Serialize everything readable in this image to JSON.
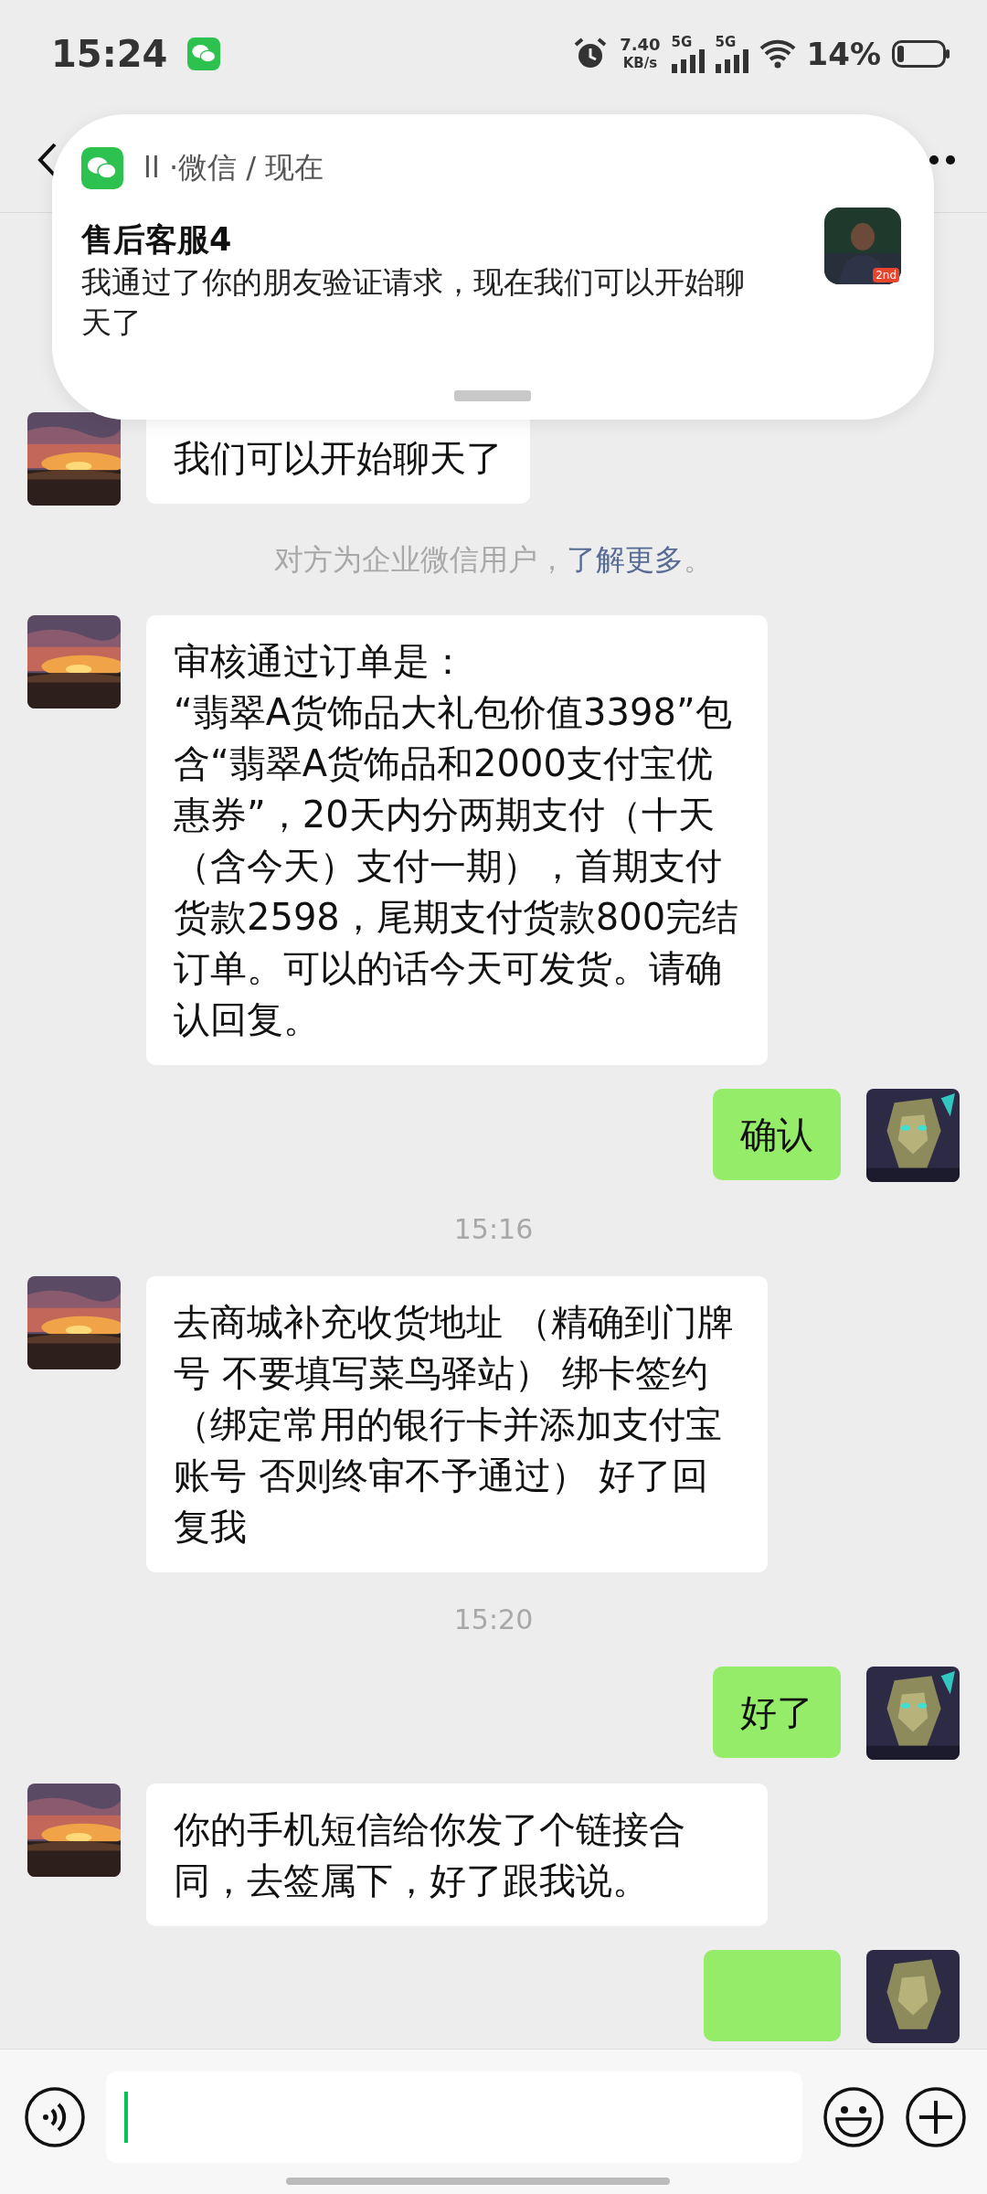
{
  "status_bar": {
    "time": "15:24",
    "speed_value": "7.40",
    "speed_unit": "KB/s",
    "network_1": "5G",
    "network_2": "5G",
    "battery": "14%"
  },
  "notification": {
    "app": "ll ·微信 / 现在",
    "sender": "售后客服4",
    "text": "我通过了你的朋友验证请求，现在我们可以开始聊天了",
    "badge": "2nd"
  },
  "messages": [
    {
      "kind": "incoming",
      "text": "我们可以开始聊天了"
    },
    {
      "kind": "system",
      "text": "对方为企业微信用户，",
      "link": "了解更多",
      "end": "。"
    },
    {
      "kind": "incoming",
      "text": "审核通过订单是：\n“翡翠A货饰品大礼包价值3398”包含“翡翠A货饰品和2000支付宝优惠券”，20天内分两期支付（十天（含今天）支付一期），首期支付货款2598，尾期支付货款800完结订单。可以的话今天可发货。请确认回复。"
    },
    {
      "kind": "outgoing",
      "text": "确认"
    },
    {
      "kind": "time",
      "text": "15:16"
    },
    {
      "kind": "incoming",
      "text": "去商城补充收货地址 （精确到门牌号 不要填写菜鸟驿站） 绑卡签约（绑定常用的银行卡并添加支付宝账号 否则终审不予通过） 好了回复我"
    },
    {
      "kind": "time",
      "text": "15:20"
    },
    {
      "kind": "outgoing",
      "text": "好了"
    },
    {
      "kind": "incoming",
      "text": "你的手机短信给你发了个链接合同，去签属下，好了跟我说。"
    },
    {
      "kind": "outgoing_cut"
    }
  ]
}
